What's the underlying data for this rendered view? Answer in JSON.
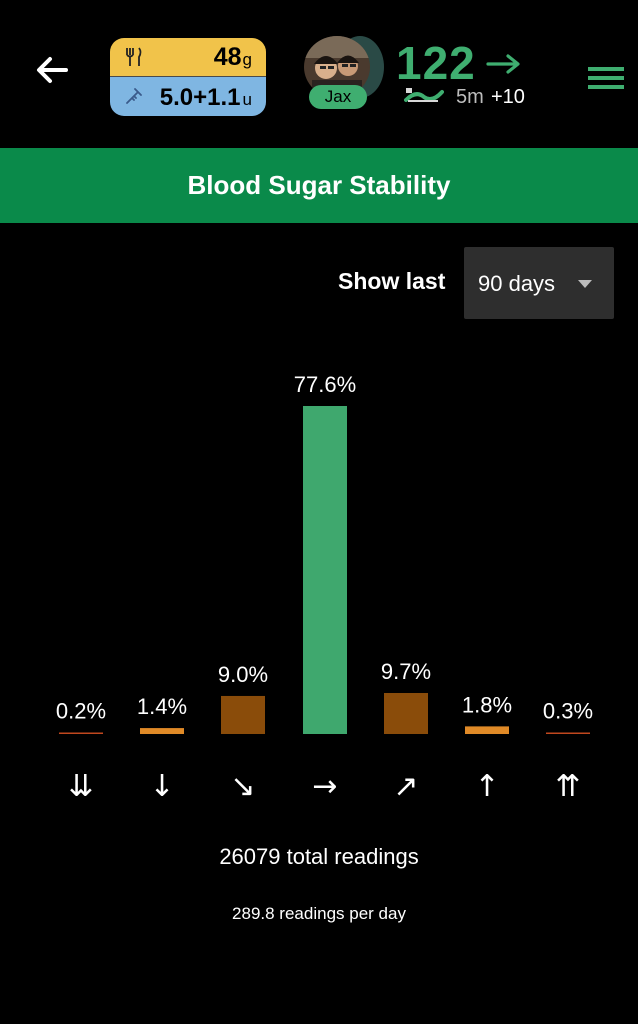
{
  "header": {
    "carbs_value": "48",
    "carbs_unit": "g",
    "insulin_value": "5.0+1.1",
    "insulin_unit": "u",
    "profile_name": "Jax",
    "glucose": "122",
    "trend": "→",
    "time_ago": "5m",
    "delta": "+10",
    "icons": [
      "back-arrow-icon",
      "fork-knife-icon",
      "syringe-icon",
      "sensor-icon",
      "hamburger-menu-icon"
    ]
  },
  "title": "Blood Sugar Stability",
  "range": {
    "label": "Show last",
    "selected": "90 days"
  },
  "chart_data": {
    "type": "bar",
    "categories": [
      "⇊",
      "↓",
      "↘",
      "→",
      "↗",
      "↑",
      "⇈"
    ],
    "values": [
      0.2,
      1.4,
      9.0,
      77.6,
      9.7,
      1.8,
      0.3
    ],
    "labels": [
      "0.2%",
      "1.4%",
      "9.0%",
      "77.6%",
      "9.7%",
      "1.8%",
      "0.3%"
    ],
    "colors": [
      "#c0471e",
      "#e08a27",
      "#8a4c0a",
      "#3fa86e",
      "#8a4c0a",
      "#e08a27",
      "#c0471e"
    ],
    "ylim": [
      0,
      77.6
    ]
  },
  "summary": {
    "total": "26079 total readings",
    "per_day": "289.8 readings per day"
  },
  "colors": {
    "accent_green": "#3fae70",
    "title_bar": "#0a8a4a",
    "carbs_bg": "#f1c34a",
    "insulin_bg": "#7fb6e2"
  }
}
